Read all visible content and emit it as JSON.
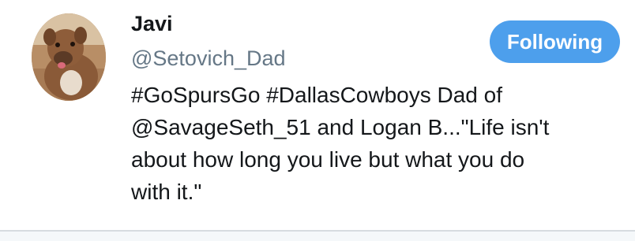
{
  "profile": {
    "display_name": "Javi",
    "handle": "@Setovich_Dad",
    "avatar_icon": "dog-photo-avatar",
    "bio_lines": [
      "#GoSpursGo #DallasCowboys Dad of",
      "@SavageSeth_51 and Logan B...\"Life isn't",
      "about how long you live but what you do",
      "with it.\""
    ]
  },
  "follow_button": {
    "label": "Following",
    "color": "#4d9fec"
  },
  "colors": {
    "name_text": "#14171a",
    "handle_text": "#657786",
    "divider": "#d7dce0"
  }
}
